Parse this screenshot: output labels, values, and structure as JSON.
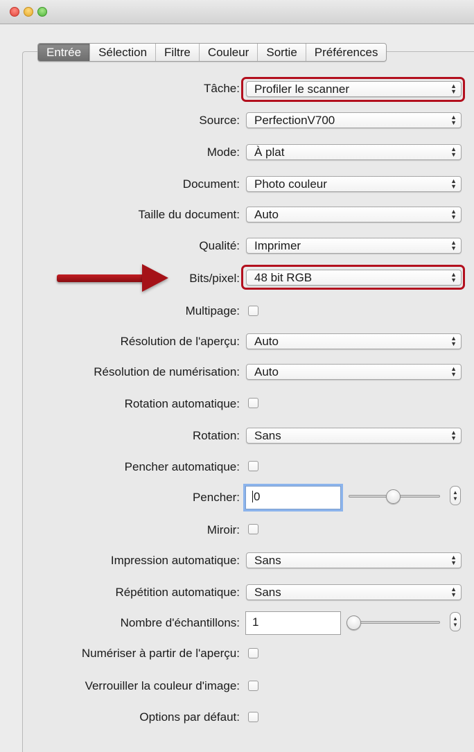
{
  "tabs": [
    "Entrée",
    "Sélection",
    "Filtre",
    "Couleur",
    "Sortie",
    "Préférences"
  ],
  "active_tab": "Entrée",
  "fields": {
    "tache": {
      "label": "Tâche:",
      "value": "Profiler le scanner"
    },
    "source": {
      "label": "Source:",
      "value": "PerfectionV700"
    },
    "mode": {
      "label": "Mode:",
      "value": "À plat"
    },
    "document": {
      "label": "Document:",
      "value": "Photo couleur"
    },
    "taille_document": {
      "label": "Taille du document:",
      "value": "Auto"
    },
    "qualite": {
      "label": "Qualité:",
      "value": "Imprimer"
    },
    "bits_pixel": {
      "label": "Bits/pixel:",
      "value": "48 bit RGB"
    },
    "multipage": {
      "label": "Multipage:",
      "checked": false
    },
    "resolution_apercu": {
      "label": "Résolution de l'aperçu:",
      "value": "Auto"
    },
    "resolution_numerisation": {
      "label": "Résolution de numérisation:",
      "value": "Auto"
    },
    "rotation_automatique": {
      "label": "Rotation automatique:",
      "checked": false
    },
    "rotation": {
      "label": "Rotation:",
      "value": "Sans"
    },
    "pencher_automatique": {
      "label": "Pencher automatique:",
      "checked": false
    },
    "pencher": {
      "label": "Pencher:",
      "value": "0"
    },
    "miroir": {
      "label": "Miroir:",
      "checked": false
    },
    "impression_automatique": {
      "label": "Impression automatique:",
      "value": "Sans"
    },
    "repetition_automatique": {
      "label": "Répétition automatique:",
      "value": "Sans"
    },
    "nombre_echantillons": {
      "label": "Nombre d'échantillons:",
      "value": "1"
    },
    "numeriser_apercu": {
      "label": "Numériser à partir de l'aperçu:",
      "checked": false
    },
    "verrouiller_couleur": {
      "label": "Verrouiller la couleur d'image:",
      "checked": false
    },
    "options_defaut": {
      "label": "Options par défaut:",
      "checked": false
    }
  },
  "highlight_color": "#b3101e",
  "annotation_arrow_color": "#a51218"
}
